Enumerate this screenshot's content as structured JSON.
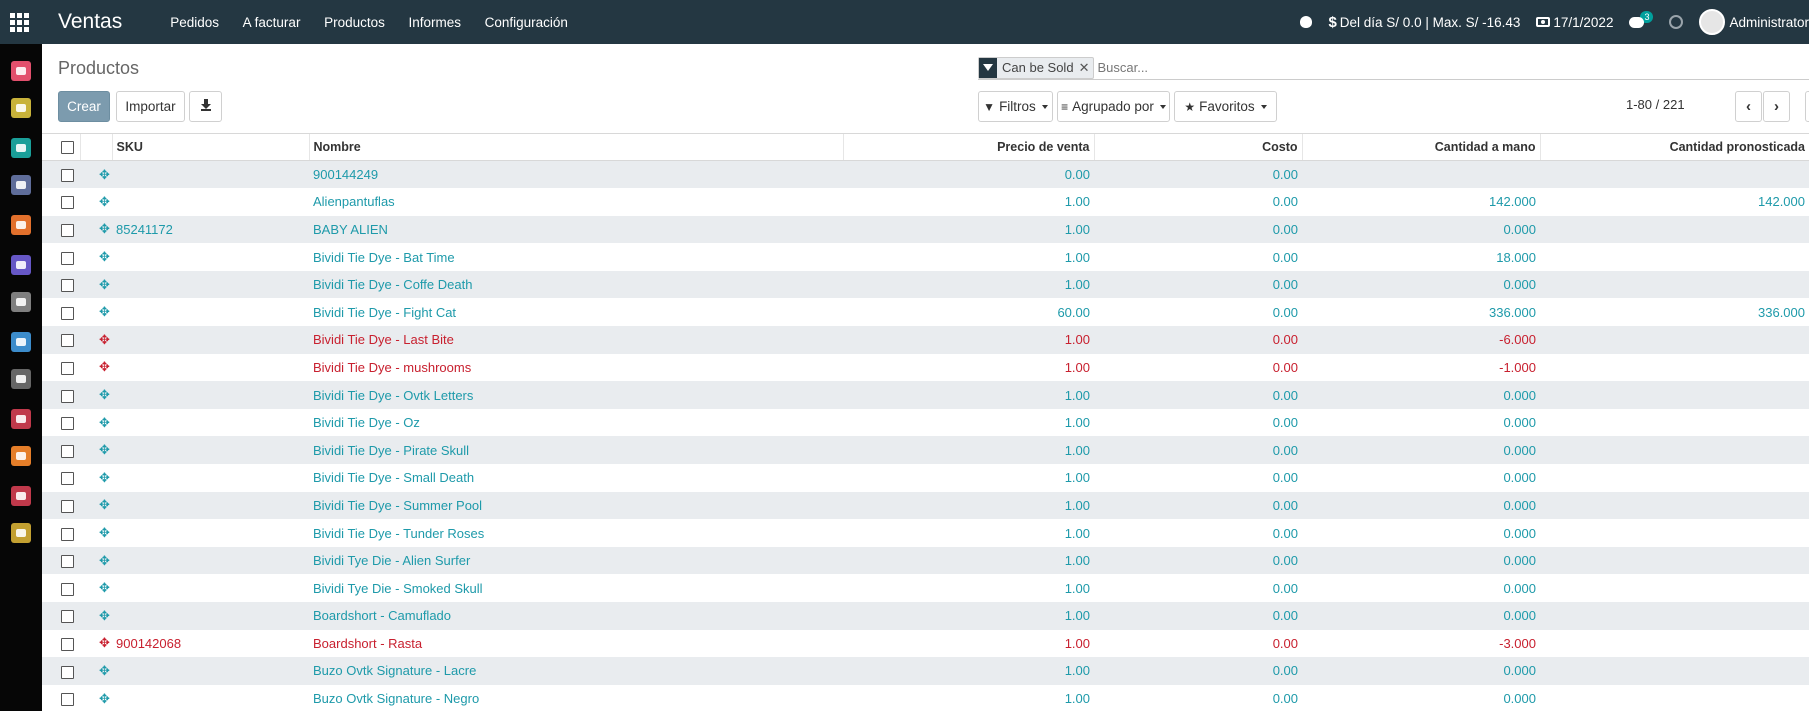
{
  "topbar": {
    "app_title": "Ventas",
    "menu": [
      "Pedidos",
      "A facturar",
      "Productos",
      "Informes",
      "Configuración"
    ],
    "cash_info": "Del día S/ 0.0 | Max. S/ -16.43",
    "date": "17/1/2022",
    "messages_count": "3",
    "user": "Administrator"
  },
  "sidebar": {
    "items": [
      {
        "icon": "chat-icon",
        "color": "#e2506d"
      },
      {
        "icon": "calendar-icon",
        "color": "#c8b23a"
      },
      {
        "icon": "contacts-icon",
        "color": "#1a9f99"
      },
      {
        "icon": "handshake-icon",
        "color": "#5f6d9a"
      },
      {
        "icon": "chart-icon",
        "color": "#e2702c"
      },
      {
        "icon": "odoo-icon",
        "color": "#6657c6"
      },
      {
        "icon": "store-icon",
        "color": "#7f7f7f"
      },
      {
        "icon": "card-icon",
        "color": "#3c8ccb"
      },
      {
        "icon": "link-icon",
        "color": "#666666"
      },
      {
        "icon": "box-icon",
        "color": "#c0394b"
      },
      {
        "icon": "clipboard-icon",
        "color": "#e57e29"
      },
      {
        "icon": "cogs-icon",
        "color": "#c0394b"
      },
      {
        "icon": "settings-icon",
        "color": "#c3a031"
      }
    ]
  },
  "control": {
    "breadcrumb": "Productos",
    "facet_value": "Can be Sold",
    "search_placeholder": "Buscar...",
    "create_label": "Crear",
    "import_label": "Importar",
    "filters_label": "Filtros",
    "groupby_label": "Agrupado por",
    "favorites_label": "Favoritos",
    "pager": "1-80 / 221"
  },
  "table": {
    "columns": [
      "SKU",
      "Nombre",
      "Precio de venta",
      "Costo",
      "Cantidad a mano",
      "Cantidad pronosticada"
    ],
    "rows": [
      {
        "sku": "",
        "name": "900144249",
        "price": "0.00",
        "cost": "0.00",
        "onhand": "",
        "forecast": "",
        "neg": false
      },
      {
        "sku": "",
        "name": "Alienpantuflas",
        "price": "1.00",
        "cost": "0.00",
        "onhand": "142.000",
        "forecast": "142.000",
        "neg": false
      },
      {
        "sku": "85241172",
        "name": "BABY ALIEN",
        "price": "1.00",
        "cost": "0.00",
        "onhand": "0.000",
        "forecast": "",
        "neg": false
      },
      {
        "sku": "",
        "name": "Bividi Tie Dye - Bat Time",
        "price": "1.00",
        "cost": "0.00",
        "onhand": "18.000",
        "forecast": "",
        "neg": false
      },
      {
        "sku": "",
        "name": "Bividi Tie Dye - Coffe Death",
        "price": "1.00",
        "cost": "0.00",
        "onhand": "0.000",
        "forecast": "",
        "neg": false
      },
      {
        "sku": "",
        "name": "Bividi Tie Dye - Fight Cat",
        "price": "60.00",
        "cost": "0.00",
        "onhand": "336.000",
        "forecast": "336.000",
        "neg": false
      },
      {
        "sku": "",
        "name": "Bividi Tie Dye - Last Bite",
        "price": "1.00",
        "cost": "0.00",
        "onhand": "-6.000",
        "forecast": "",
        "neg": true
      },
      {
        "sku": "",
        "name": "Bividi Tie Dye - mushrooms",
        "price": "1.00",
        "cost": "0.00",
        "onhand": "-1.000",
        "forecast": "",
        "neg": true
      },
      {
        "sku": "",
        "name": "Bividi Tie Dye - Ovtk Letters",
        "price": "1.00",
        "cost": "0.00",
        "onhand": "0.000",
        "forecast": "",
        "neg": false
      },
      {
        "sku": "",
        "name": "Bividi Tie Dye - Oz",
        "price": "1.00",
        "cost": "0.00",
        "onhand": "0.000",
        "forecast": "",
        "neg": false
      },
      {
        "sku": "",
        "name": "Bividi Tie Dye - Pirate Skull",
        "price": "1.00",
        "cost": "0.00",
        "onhand": "0.000",
        "forecast": "",
        "neg": false
      },
      {
        "sku": "",
        "name": "Bividi Tie Dye - Small Death",
        "price": "1.00",
        "cost": "0.00",
        "onhand": "0.000",
        "forecast": "",
        "neg": false
      },
      {
        "sku": "",
        "name": "Bividi Tie Dye - Summer Pool",
        "price": "1.00",
        "cost": "0.00",
        "onhand": "0.000",
        "forecast": "",
        "neg": false
      },
      {
        "sku": "",
        "name": "Bividi Tie Dye - Tunder Roses",
        "price": "1.00",
        "cost": "0.00",
        "onhand": "0.000",
        "forecast": "",
        "neg": false
      },
      {
        "sku": "",
        "name": "Bividi Tye Die - Alien Surfer",
        "price": "1.00",
        "cost": "0.00",
        "onhand": "0.000",
        "forecast": "",
        "neg": false
      },
      {
        "sku": "",
        "name": "Bividi Tye Die - Smoked Skull",
        "price": "1.00",
        "cost": "0.00",
        "onhand": "0.000",
        "forecast": "",
        "neg": false
      },
      {
        "sku": "",
        "name": "Boardshort - Camuflado",
        "price": "1.00",
        "cost": "0.00",
        "onhand": "0.000",
        "forecast": "",
        "neg": false
      },
      {
        "sku": "900142068",
        "name": "Boardshort - Rasta",
        "price": "1.00",
        "cost": "0.00",
        "onhand": "-3.000",
        "forecast": "",
        "neg": true
      },
      {
        "sku": "",
        "name": "Buzo Ovtk Signature - Lacre",
        "price": "1.00",
        "cost": "0.00",
        "onhand": "0.000",
        "forecast": "",
        "neg": false
      },
      {
        "sku": "",
        "name": "Buzo Ovtk Signature - Negro",
        "price": "1.00",
        "cost": "0.00",
        "onhand": "0.000",
        "forecast": "",
        "neg": false
      }
    ]
  }
}
